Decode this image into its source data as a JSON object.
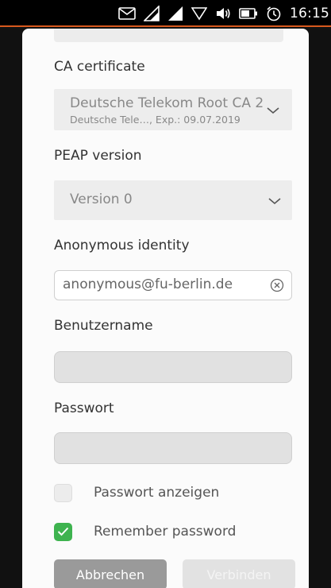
{
  "status": {
    "clock": "16:15",
    "icons": [
      "message-icon",
      "cellular-signal-icon",
      "cellular-signal-icon",
      "wifi-icon",
      "volume-icon",
      "battery-icon",
      "alarm-icon"
    ],
    "accent": "#d8591e"
  },
  "form": {
    "ca_cert": {
      "label": "CA certificate",
      "value": "Deutsche Telekom Root CA 2",
      "detail": "Deutsche Tele…, Exp.: 09.07.2019"
    },
    "peap": {
      "label": "PEAP version",
      "value": "Version 0"
    },
    "anonymous": {
      "label": "Anonymous identity",
      "value": "anonymous@fu-berlin.de"
    },
    "username": {
      "label": "Benutzername",
      "value": ""
    },
    "password": {
      "label": "Passwort",
      "value": ""
    },
    "show_password": {
      "label": "Passwort anzeigen",
      "checked": false
    },
    "remember_password": {
      "label": "Remember password",
      "checked": true,
      "color": "#3eb34f"
    }
  },
  "buttons": {
    "cancel": "Abbrechen",
    "connect": "Verbinden"
  }
}
